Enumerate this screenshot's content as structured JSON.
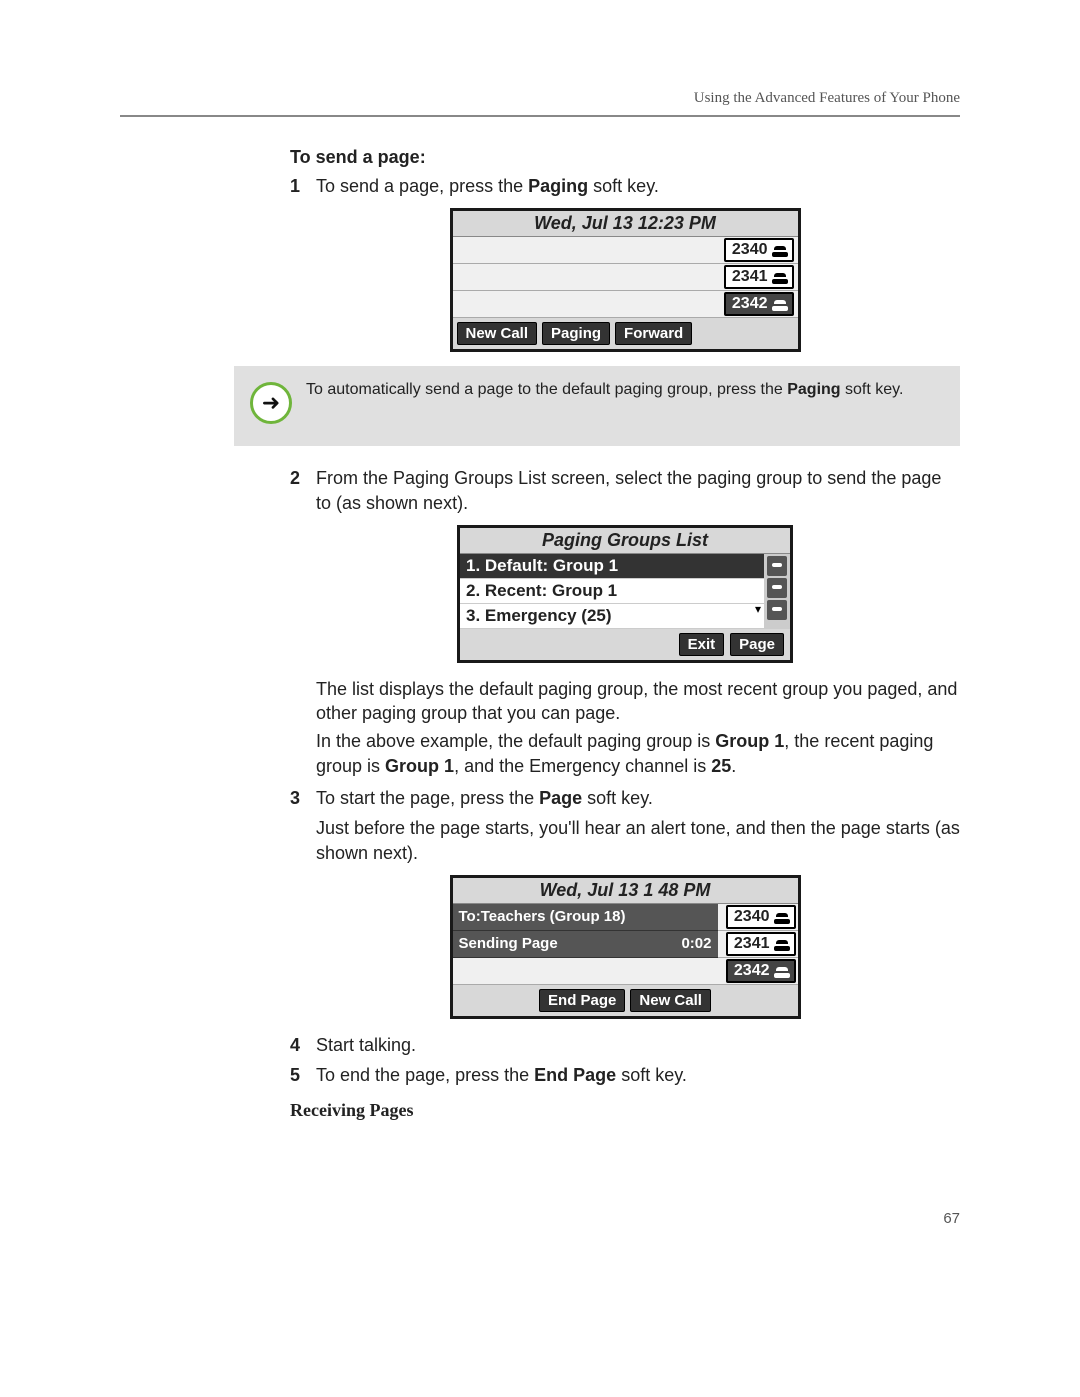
{
  "header": {
    "running_head": "Using the Advanced Features of Your Phone"
  },
  "section_title": "To send a page:",
  "steps": {
    "s1": {
      "num": "1",
      "pre": "To send a page, press the ",
      "key": "Paging",
      "post": " soft key."
    },
    "s2": {
      "num": "2",
      "text": "From the Paging Groups List screen, select the paging group to send the page to (as shown next)."
    },
    "s2_p1": "The list displays the default paging group, the most recent group you paged, and other paging group that you can page.",
    "s2_p2_pre": "In the above example, the default paging group is ",
    "s2_p2_g1": "Group 1",
    "s2_p2_mid": ", the recent paging group is ",
    "s2_p2_g2": "Group 1",
    "s2_p2_mid2": ", and the Emergency channel is ",
    "s2_p2_ch": "25",
    "s2_p2_end": ".",
    "s3": {
      "num": "3",
      "pre": "To start the page, press the ",
      "key": "Page",
      "post": " soft key."
    },
    "s3_p1": "Just before the page starts, you'll hear an alert tone, and then the page starts (as shown next).",
    "s4": {
      "num": "4",
      "text": "Start talking."
    },
    "s5": {
      "num": "5",
      "pre": "To end the page, press the ",
      "key": "End Page",
      "post": " soft key."
    }
  },
  "tip": {
    "pre": "To automatically send a page to the default paging group, press the ",
    "bold": "Paging",
    "post": " soft key."
  },
  "screen1": {
    "datetime": "Wed, Jul 13   12:23 PM",
    "lines": [
      "2340",
      "2341",
      "2342"
    ],
    "softkeys": [
      "New Call",
      "Paging",
      "Forward"
    ]
  },
  "screen2": {
    "title": "Paging Groups List",
    "items": [
      "1. Default: Group 1",
      "2. Recent: Group 1",
      "3. Emergency (25)"
    ],
    "softkeys": [
      "Exit",
      "Page"
    ]
  },
  "screen3": {
    "datetime": "Wed, Jul 13   1 48 PM",
    "to_line": "To:Teachers (Group 18)",
    "status": "Sending Page",
    "timer": "0:02",
    "lines": [
      "2340",
      "2341",
      "2342"
    ],
    "softkeys": [
      "End Page",
      "New Call"
    ]
  },
  "subhead": "Receiving Pages",
  "page_number": "67"
}
